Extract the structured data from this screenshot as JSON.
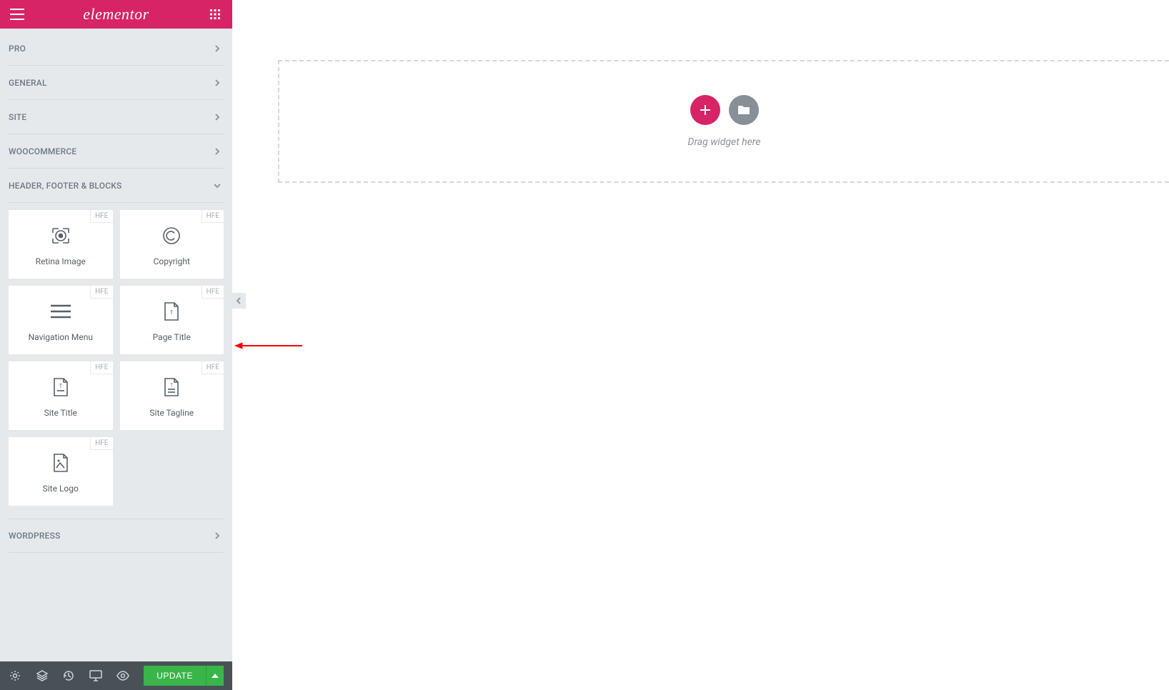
{
  "header": {
    "logo_text": "elementor"
  },
  "categories": {
    "closed": [
      {
        "label": "PRO"
      },
      {
        "label": "GENERAL"
      },
      {
        "label": "SITE"
      },
      {
        "label": "WOOCOMMERCE"
      }
    ],
    "open": {
      "label": "HEADER, FOOTER & BLOCKS"
    },
    "after": [
      {
        "label": "WORDPRESS"
      }
    ]
  },
  "widgets_badge": "HFE",
  "widgets": [
    {
      "label": "Retina Image",
      "icon": "retina"
    },
    {
      "label": "Copyright",
      "icon": "copyright"
    },
    {
      "label": "Navigation Menu",
      "icon": "navmenu"
    },
    {
      "label": "Page Title",
      "icon": "pagetitle"
    },
    {
      "label": "Site Title",
      "icon": "sitetitle"
    },
    {
      "label": "Site Tagline",
      "icon": "sitetagline"
    },
    {
      "label": "Site Logo",
      "icon": "sitelogo"
    }
  ],
  "footer": {
    "update_label": "UPDATE"
  },
  "canvas": {
    "hint": "Drag widget here"
  }
}
